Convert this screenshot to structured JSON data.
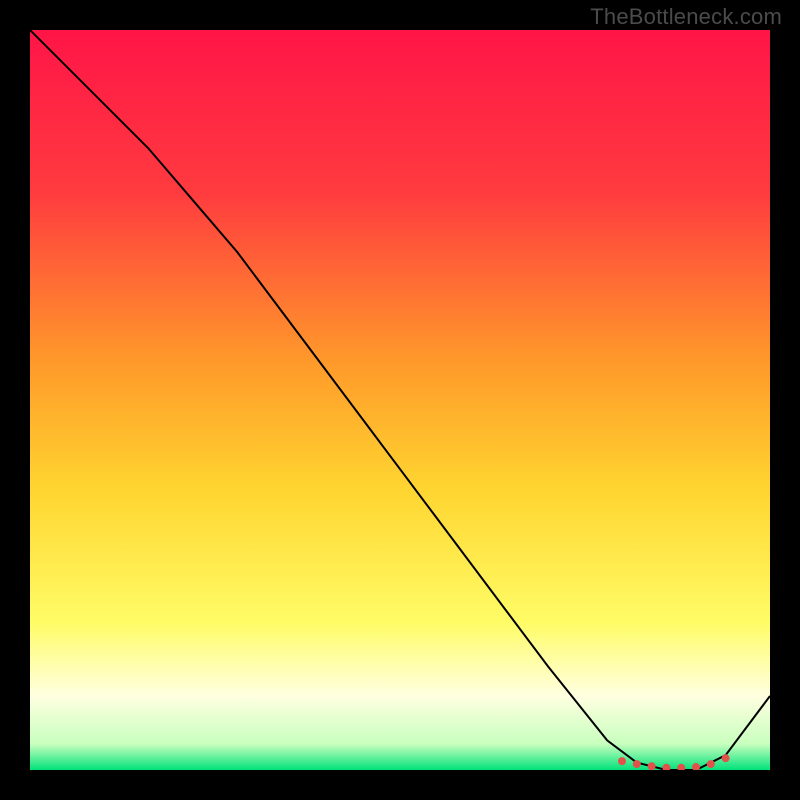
{
  "watermark": "TheBottleneck.com",
  "chart_data": {
    "type": "line",
    "title": "",
    "xlabel": "",
    "ylabel": "",
    "xlim": [
      0,
      100
    ],
    "ylim": [
      0,
      100
    ],
    "grid": false,
    "legend": false,
    "background_gradient_stops": [
      {
        "offset": 0.0,
        "color": "#ff1547"
      },
      {
        "offset": 0.22,
        "color": "#ff3b3f"
      },
      {
        "offset": 0.45,
        "color": "#ff9a2a"
      },
      {
        "offset": 0.62,
        "color": "#ffd530"
      },
      {
        "offset": 0.8,
        "color": "#fffc66"
      },
      {
        "offset": 0.9,
        "color": "#ffffe0"
      },
      {
        "offset": 0.965,
        "color": "#c8ffbe"
      },
      {
        "offset": 1.0,
        "color": "#00e27a"
      }
    ],
    "series": [
      {
        "name": "curve",
        "color": "#000000",
        "stroke_width": 2,
        "x": [
          0,
          8,
          16,
          22,
          28,
          40,
          55,
          70,
          78,
          82,
          86,
          90,
          94,
          100
        ],
        "values": [
          100,
          92,
          84,
          77,
          70,
          54,
          34,
          14,
          4,
          1,
          0,
          0,
          2,
          10
        ]
      }
    ],
    "markers": {
      "name": "selected-range",
      "color": "#e1524a",
      "radius": 4,
      "x": [
        80,
        82,
        84,
        86,
        88,
        90,
        92,
        94
      ],
      "values": [
        1.2,
        0.8,
        0.5,
        0.3,
        0.3,
        0.4,
        0.8,
        1.6
      ]
    }
  }
}
